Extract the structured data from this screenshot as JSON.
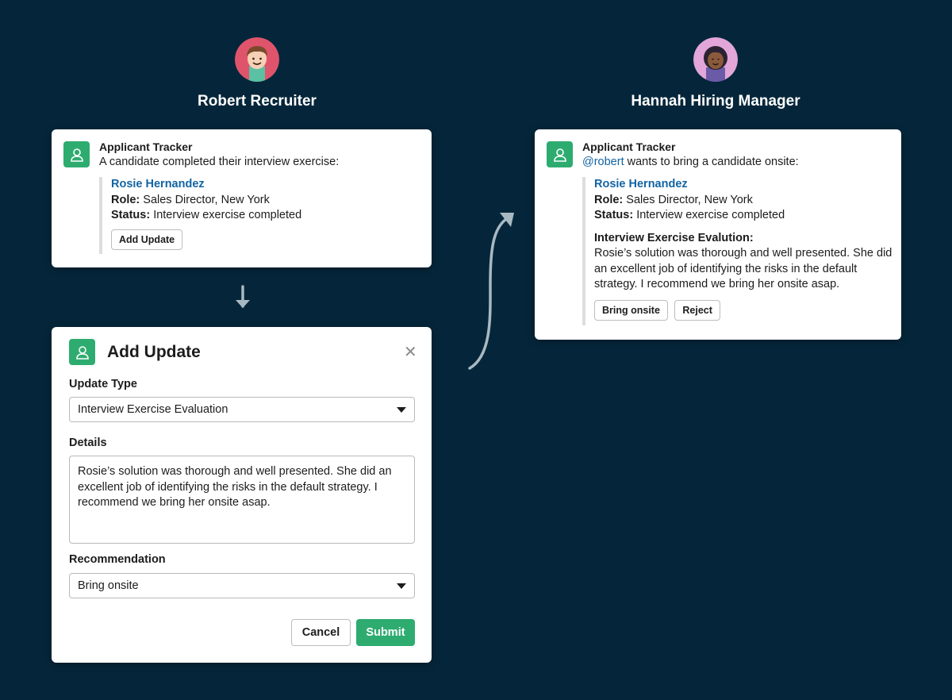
{
  "personas": {
    "left": {
      "name": "Robert Recruiter"
    },
    "right": {
      "name": "Hannah Hiring Manager"
    }
  },
  "card_left": {
    "app_name": "Applicant Tracker",
    "message": "A candidate completed their interview exercise:",
    "candidate_name": "Rosie Hernandez",
    "role_label": "Role:",
    "role_value": "Sales Director, New York",
    "status_label": "Status:",
    "status_value": "Interview exercise completed",
    "add_update_label": "Add Update"
  },
  "card_right": {
    "app_name": "Applicant Tracker",
    "mention": "@robert",
    "message_rest": " wants to bring a candidate onsite:",
    "candidate_name": "Rosie Hernandez",
    "role_label": "Role:",
    "role_value": "Sales Director, New York",
    "status_label": "Status:",
    "status_value": "Interview exercise completed",
    "evaluation_label": "Interview Exercise Evalution:",
    "evaluation_lines": [
      "Rosie’s solution was thorough and well presented. She did",
      "an excellent job of identifying the risks in the default",
      "strategy. I recommend we bring her onsite asap."
    ],
    "bring_onsite_label": "Bring onsite",
    "reject_label": "Reject"
  },
  "modal": {
    "title": "Add Update",
    "update_type_label": "Update Type",
    "update_type_value": "Interview Exercise Evaluation",
    "details_label": "Details",
    "details_lines": [
      "Rosie’s solution was thorough and well presented. She did an",
      "excellent job of identifying the risks in the default strategy. I",
      "recommend we bring her onsite asap."
    ],
    "recommendation_label": "Recommendation",
    "recommendation_value": "Bring onsite",
    "cancel_label": "Cancel",
    "submit_label": "Submit"
  },
  "colors": {
    "background": "#05263a",
    "accent_green": "#2eac70",
    "link_blue": "#1264a3",
    "arrow_gray": "#a9b9c2"
  },
  "icons": {
    "app": "user-icon",
    "close": "close-icon",
    "caret": "caret-down-icon"
  }
}
